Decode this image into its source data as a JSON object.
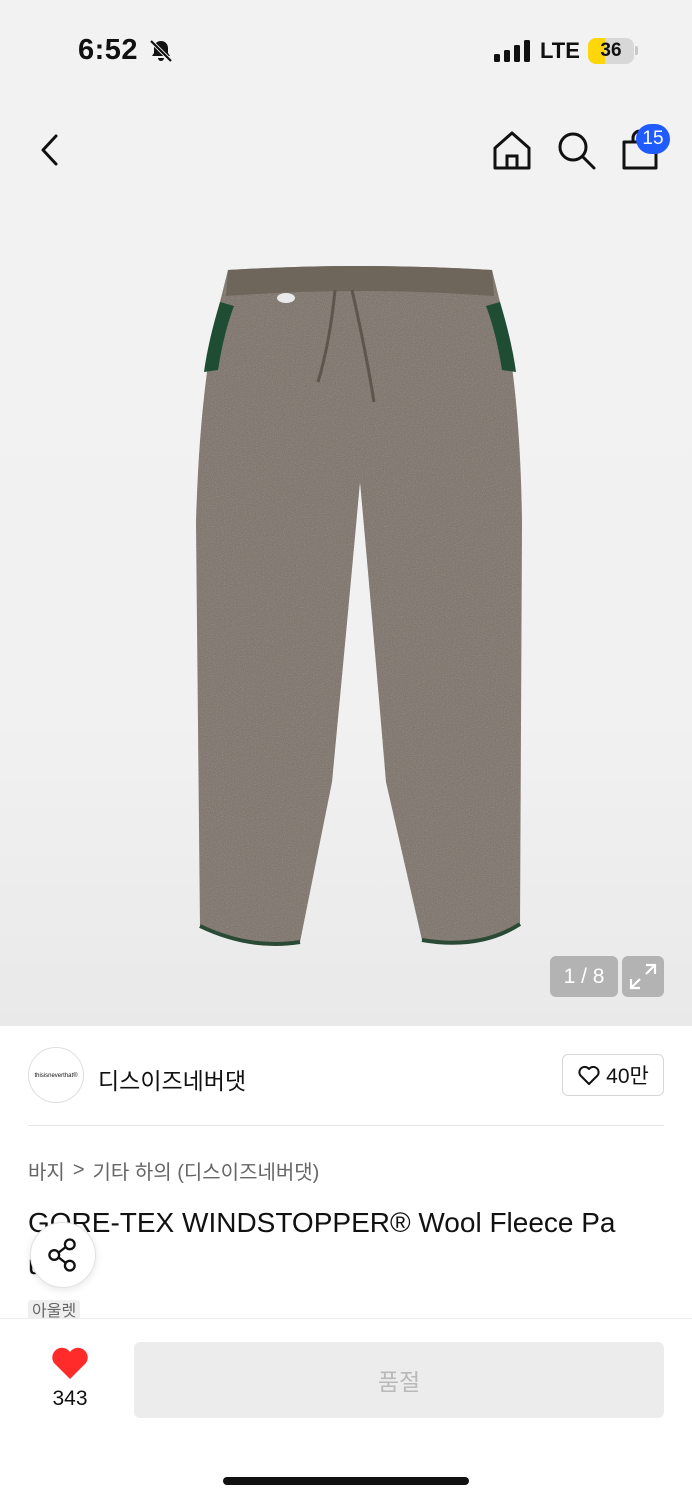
{
  "status_bar": {
    "time": "6:52",
    "network": "LTE",
    "battery": "36",
    "battery_level": 0.36,
    "battery_color": "#ffd60a"
  },
  "nav": {
    "back_icon": "chevron-left-icon",
    "home_icon": "home-icon",
    "search_icon": "search-icon",
    "cart_icon": "shopping-bag-icon",
    "cart_count": "15",
    "badge_color": "#1f5bff"
  },
  "gallery": {
    "counter": "1 / 8",
    "expand_icon": "expand-icon"
  },
  "brand": {
    "logo_text": "thisisneverthat®",
    "name": "디스이즈네버댓",
    "like_count": "40만"
  },
  "breadcrumb": {
    "category": "바지",
    "separator": ">",
    "subcategory": "기타 하의 (디스이즈네버댓)"
  },
  "product": {
    "title": "GORE-TEX WINDSTOPPER® Wool Fleece Pa       ud",
    "tag": "아울렛"
  },
  "bottom_bar": {
    "like_count": "343",
    "heart_color": "#ff2b2b",
    "cta_label": "품절"
  }
}
